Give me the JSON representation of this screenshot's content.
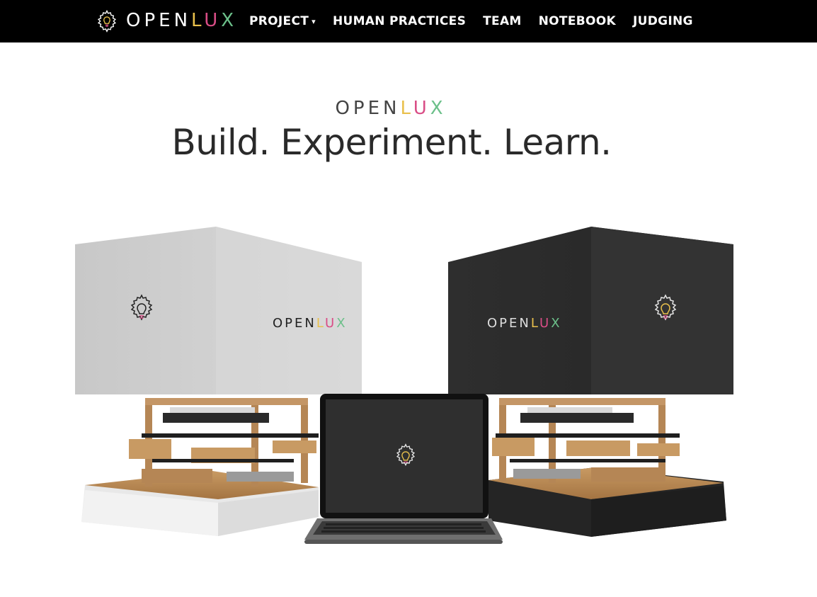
{
  "brand": {
    "wordmark_parts": [
      "OPEN",
      "L",
      "U",
      "X"
    ],
    "colors": {
      "open": "#ffffff",
      "l": "#e9c04c",
      "u": "#d94d86",
      "x": "#6cc08a"
    },
    "logo_icon": "gear-lightbulb-icon"
  },
  "nav": {
    "items": [
      {
        "label": "PROJECT",
        "has_dropdown": true,
        "caret": "▾"
      },
      {
        "label": "HUMAN PRACTICES"
      },
      {
        "label": "TEAM"
      },
      {
        "label": "NOTEBOOK"
      },
      {
        "label": "JUDGING"
      }
    ]
  },
  "hero": {
    "wordmark_parts": [
      "OPEN",
      "L",
      "U",
      "X"
    ],
    "tagline": "Build. Experiment. Learn."
  },
  "product_scene": {
    "left_device": {
      "cover_color": "#cfcfcf",
      "label_parts": [
        "OPEN",
        "L",
        "U",
        "X"
      ]
    },
    "right_device": {
      "cover_color": "#2b2b2b",
      "label_parts": [
        "OPEN",
        "L",
        "U",
        "X"
      ]
    },
    "laptop": {
      "screen_color": "#2f2f2f"
    }
  }
}
